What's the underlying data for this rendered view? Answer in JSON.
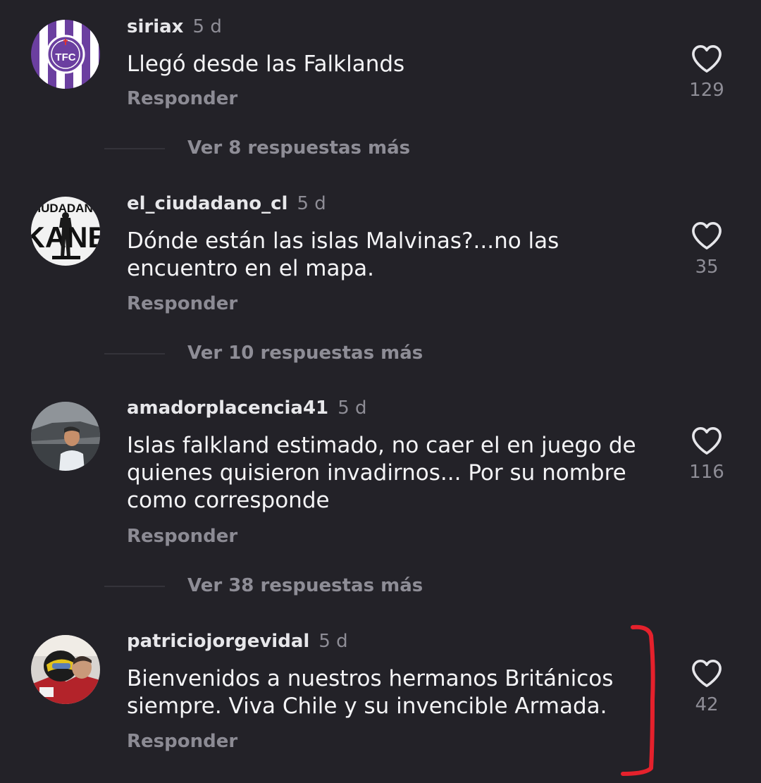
{
  "comments": [
    {
      "username": "siriax",
      "time": "5 d",
      "text": "Llegó desde las Falklands",
      "likes": "129",
      "reply_label": "Responder",
      "more_replies": "Ver 8 respuestas más",
      "avatar_icon": "tfc-crest-avatar"
    },
    {
      "username": "el_ciudadano_cl",
      "time": "5 d",
      "text": "Dónde están las islas Malvinas?...no las encuentro en el mapa.",
      "likes": "35",
      "reply_label": "Responder",
      "more_replies": "Ver 10 respuestas más",
      "avatar_icon": "ciudadano-kane-poster-avatar",
      "avatar_text_top": "CIUDADANO",
      "avatar_text_main": "KANE"
    },
    {
      "username": "amadorplacencia41",
      "time": "5 d",
      "text": "Islas falkland estimado, no caer el en juego de quienes quisieron invadirnos... Por su nombre como corresponde",
      "likes": "116",
      "reply_label": "Responder",
      "more_replies": "Ver 38 respuestas más",
      "avatar_icon": "man-in-car-photo-avatar"
    },
    {
      "username": "patriciojorgevidal",
      "time": "5 d",
      "text": "Bienvenidos a nuestros hermanos Británicos siempre. Viva Chile y su invencible Armada.",
      "likes": "42",
      "reply_label": "Responder",
      "avatar_icon": "racing-helmet-photo-avatar"
    }
  ],
  "colors": {
    "background": "#232228",
    "marker": "#e5212c"
  }
}
